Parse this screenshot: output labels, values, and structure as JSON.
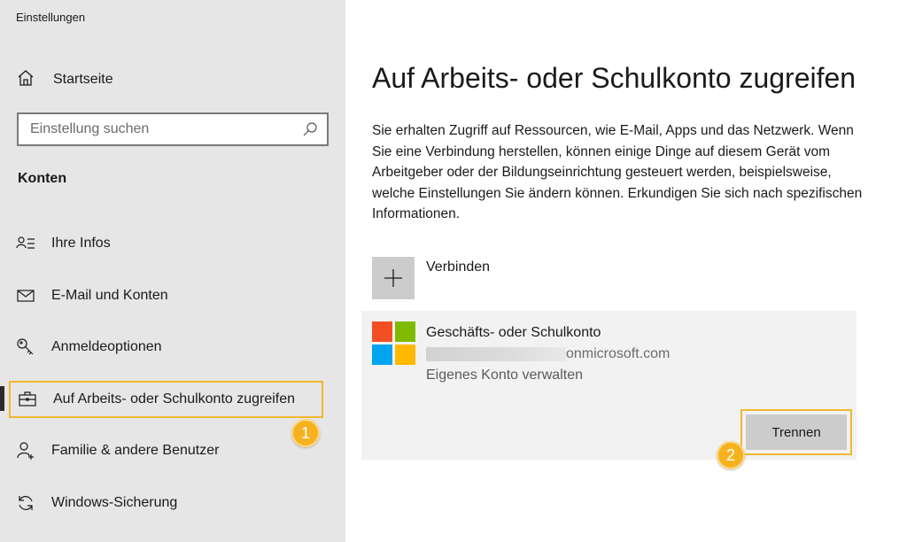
{
  "app": {
    "title": "Einstellungen"
  },
  "sidebar": {
    "home_label": "Startseite",
    "search_placeholder": "Einstellung suchen",
    "section_title": "Konten",
    "items": [
      {
        "label": "Ihre Infos",
        "icon": "person-list-icon"
      },
      {
        "label": "E-Mail und Konten",
        "icon": "mail-icon"
      },
      {
        "label": "Anmeldeoptionen",
        "icon": "key-icon"
      },
      {
        "label": "Auf Arbeits- oder Schulkonto zugreifen",
        "icon": "briefcase-icon",
        "active": true
      },
      {
        "label": "Familie & andere Benutzer",
        "icon": "person-add-icon"
      },
      {
        "label": "Windows-Sicherung",
        "icon": "sync-icon"
      }
    ]
  },
  "annotations": {
    "marker1": "1",
    "marker2": "2",
    "highlight_color": "#f2b630"
  },
  "main": {
    "title": "Auf Arbeits- oder Schulkonto zugreifen",
    "description": "Sie erhalten Zugriff auf Ressourcen, wie E-Mail, Apps und das Netzwerk. Wenn Sie eine Verbindung herstellen, können einige Dinge auf diesem Gerät vom Arbeitgeber oder der Bildungseinrichtung gesteuert werden, beispielsweise, welche Einstellungen Sie ändern können. Erkundigen Sie sich nach spezifischen Informationen.",
    "connect_label": "Verbinden",
    "account": {
      "name": "Geschäfts- oder Schulkonto",
      "email_suffix": "onmicrosoft.com",
      "manage_label": "Eigenes Konto verwalten",
      "disconnect_label": "Trennen"
    }
  }
}
